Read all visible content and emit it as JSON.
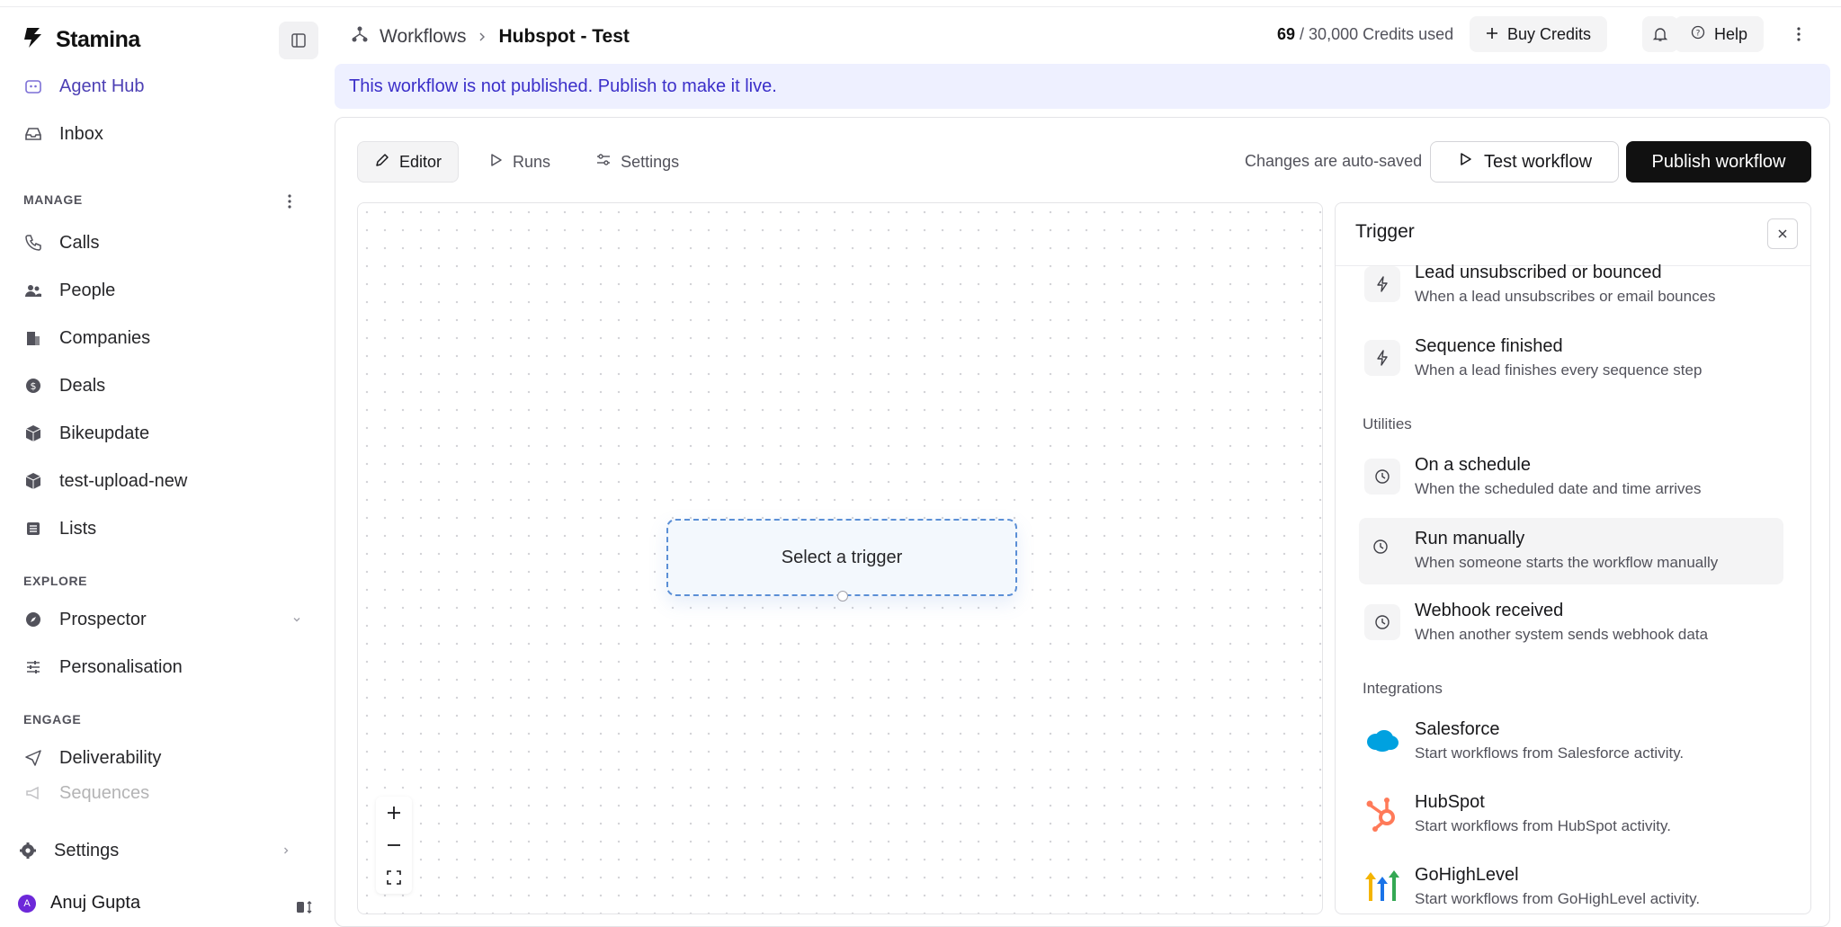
{
  "sidebar": {
    "brand": "Stamina",
    "items_top": [
      {
        "label": "Agent Hub"
      },
      {
        "label": "Inbox"
      }
    ],
    "manage_label": "MANAGE",
    "manage_items": [
      {
        "label": "Calls"
      },
      {
        "label": "People"
      },
      {
        "label": "Companies"
      },
      {
        "label": "Deals"
      },
      {
        "label": "Bikeupdate"
      },
      {
        "label": "test-upload-new"
      },
      {
        "label": "Lists"
      }
    ],
    "explore_label": "EXPLORE",
    "explore_items": [
      {
        "label": "Prospector"
      },
      {
        "label": "Personalisation"
      }
    ],
    "engage_label": "ENGAGE",
    "engage_items": [
      {
        "label": "Deliverability"
      },
      {
        "label": "Sequences"
      }
    ],
    "settings_label": "Settings",
    "user": {
      "name": "Anuj Gupta",
      "initial": "A"
    }
  },
  "header": {
    "breadcrumb_root": "Workflows",
    "breadcrumb_current": "Hubspot - Test",
    "credits_used": "69",
    "credits_total": "/ 30,000 Credits used",
    "buy_credits": "Buy Credits",
    "help": "Help"
  },
  "banner": {
    "text": "This workflow is not published. Publish to make it live."
  },
  "toolbar": {
    "tabs": [
      {
        "label": "Editor"
      },
      {
        "label": "Runs"
      },
      {
        "label": "Settings"
      }
    ],
    "autosave": "Changes are auto-saved",
    "test_label": "Test workflow",
    "publish_label": "Publish workflow"
  },
  "canvas": {
    "trigger_placeholder": "Select a trigger"
  },
  "trigger_panel": {
    "title": "Trigger",
    "items_top": [
      {
        "title": "Lead unsubscribed or bounced",
        "desc": "When a lead unsubscribes or email bounces"
      },
      {
        "title": "Sequence finished",
        "desc": "When a lead finishes every sequence step"
      }
    ],
    "utilities_label": "Utilities",
    "utilities": [
      {
        "title": "On a schedule",
        "desc": "When the scheduled date and time arrives"
      },
      {
        "title": "Run manually",
        "desc": "When someone starts the workflow manually"
      },
      {
        "title": "Webhook received",
        "desc": "When another system sends webhook data"
      }
    ],
    "integrations_label": "Integrations",
    "integrations": [
      {
        "title": "Salesforce",
        "desc": "Start workflows from Salesforce activity."
      },
      {
        "title": "HubSpot",
        "desc": "Start workflows from HubSpot activity."
      },
      {
        "title": "GoHighLevel",
        "desc": "Start workflows from GoHighLevel activity."
      }
    ]
  },
  "colors": {
    "accent": "#4c3fb4",
    "banner_bg": "#eef0ff",
    "banner_text": "#3b2fc9",
    "primary_button": "#111111",
    "node_border": "#5b8fd6",
    "hubspot": "#ff7a59",
    "salesforce": "#00a1e0"
  }
}
